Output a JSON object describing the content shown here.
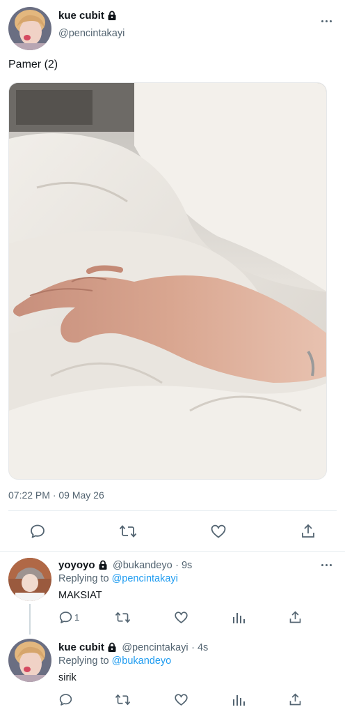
{
  "main_tweet": {
    "display_name": "kue cubit",
    "handle": "@pencintakayi",
    "text": "Pamer (2)",
    "timestamp": "07:22 PM · 09 May 26"
  },
  "replies": [
    {
      "display_name": "yoyoyo",
      "handle": "@bukandeyo",
      "time": "· 9s",
      "replying_to_prefix": "Replying to",
      "replying_to": "@pencintakayi",
      "text": "MAKSIAT",
      "reply_count": "1"
    },
    {
      "display_name": "kue cubit",
      "handle": "@pencintakayi",
      "time": "· 4s",
      "replying_to_prefix": "Replying to",
      "replying_to": "@bukandeyo",
      "text": "sirik",
      "reply_count": ""
    }
  ],
  "icons": {
    "reply": "speech-bubble-icon",
    "retweet": "retweet-icon",
    "like": "heart-icon",
    "views": "bar-chart-icon",
    "share": "share-upload-icon",
    "more": "ellipsis-icon",
    "protected": "lock-icon"
  },
  "colors": {
    "link": "#1d9bf0",
    "secondary_text": "#536471",
    "icon": "#536471"
  }
}
